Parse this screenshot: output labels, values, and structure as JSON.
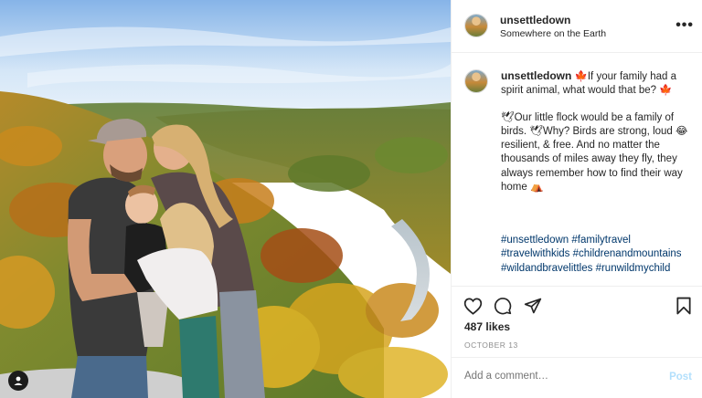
{
  "post": {
    "username": "unsettledown",
    "location": "Somewhere on the Earth",
    "more_label": "•••"
  },
  "caption": {
    "username": "unsettledown",
    "line1": "🍁If your family had a spirit animal, what would that be? 🍁",
    "line2": "🕊Our little flock would be a family of birds. 🕊Why? Birds are strong, loud 😂 resilient, & free. And no matter the thousands of miles away they fly, they always remember how to find their way home ⛺"
  },
  "hashtags": [
    "#unsettledown",
    "#familytravel",
    "#travelwithkids",
    "#childrenandmountains",
    "#wildandbravelittles",
    "#runwildmychild"
  ],
  "actions": {
    "likes": "487 likes",
    "date": "OCTOBER 13"
  },
  "comment": {
    "placeholder": "Add a comment…",
    "post_label": "Post"
  },
  "icons": {
    "like": "heart-icon",
    "comment": "comment-icon",
    "share": "share-icon",
    "save": "bookmark-icon",
    "tagged": "user-tag-icon"
  },
  "colors": {
    "hashtag": "#00376b",
    "post_button": "#b2dffc",
    "muted": "#8e8e8e"
  }
}
